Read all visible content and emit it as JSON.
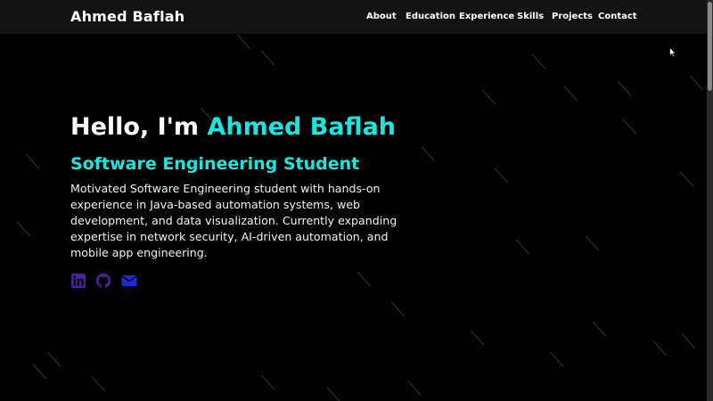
{
  "navbar": {
    "brand": "Ahmed Baflah",
    "links": [
      "About",
      "Education",
      "Experience",
      "Skills",
      "Projects",
      "Contact"
    ]
  },
  "hero": {
    "greeting": "Hello, I'm",
    "name": "Ahmed Baflah",
    "role": "Software Engineering Student",
    "description": "Motivated Software Engineering student with hands-on experience in Java-based automation systems, web development, and data visualization. Currently expanding expertise in network security, AI-driven automation, and mobile app engineering."
  },
  "socials": [
    {
      "icon": "linkedin-icon",
      "color": "#4b1f9e"
    },
    {
      "icon": "github-icon",
      "color": "#4b1f9e"
    },
    {
      "icon": "mail-icon",
      "color": "#1d2bd6"
    }
  ],
  "colors": {
    "background": "#000000",
    "navbar": "#131313",
    "accent": "#19e6e0"
  }
}
